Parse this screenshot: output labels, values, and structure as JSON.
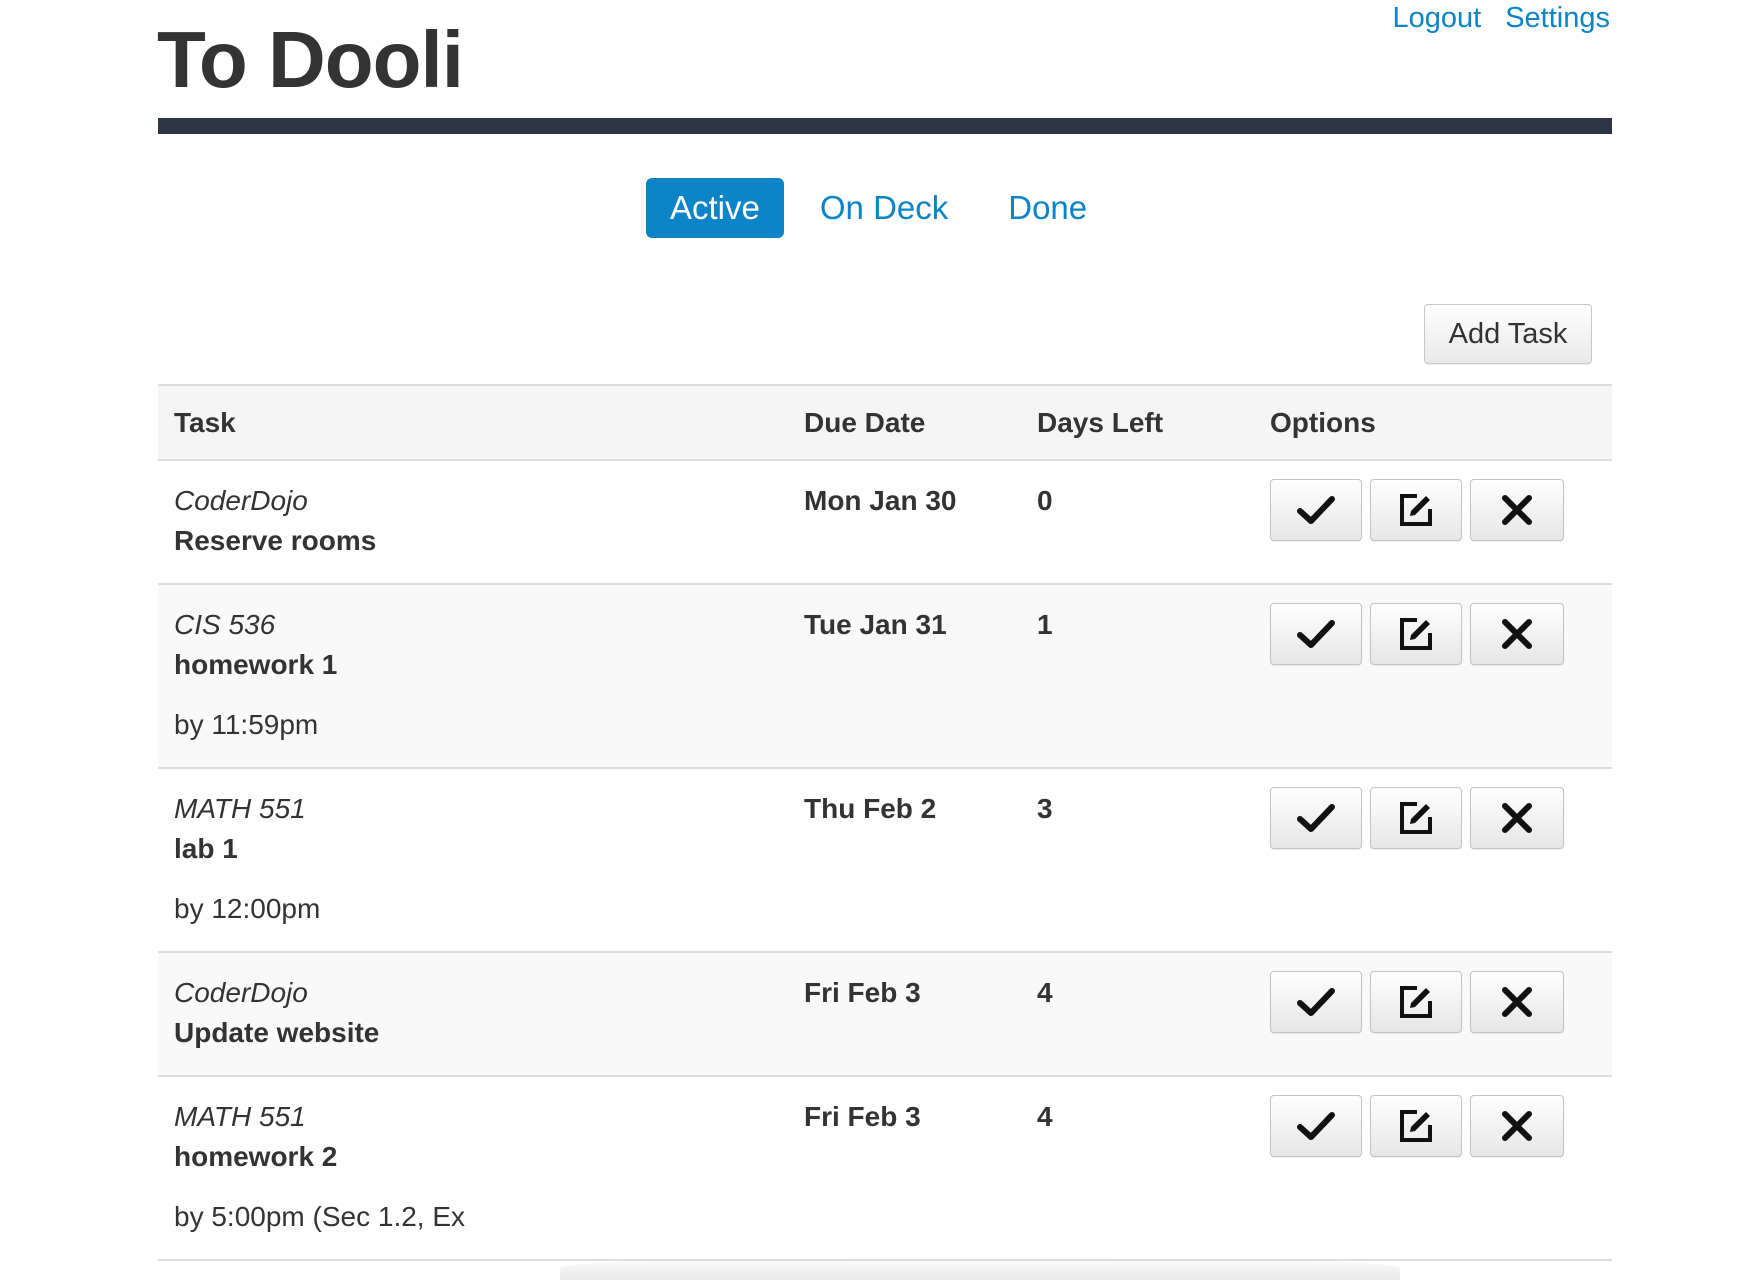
{
  "app": {
    "title": "To Dooli"
  },
  "header_links": {
    "logout": "Logout",
    "settings": "Settings"
  },
  "tabs": [
    {
      "label": "Active",
      "active": true
    },
    {
      "label": "On Deck",
      "active": false
    },
    {
      "label": "Done",
      "active": false
    }
  ],
  "toolbar": {
    "add_task_label": "Add Task"
  },
  "table": {
    "columns": [
      "Task",
      "Due Date",
      "Days Left",
      "Options"
    ],
    "rows": [
      {
        "course": "CoderDojo",
        "task": "Reserve rooms",
        "note": "",
        "due": "Mon Jan 30",
        "days_left": "0"
      },
      {
        "course": "CIS 536",
        "task": "homework 1",
        "note": "by 11:59pm",
        "due": "Tue Jan 31",
        "days_left": "1"
      },
      {
        "course": "MATH 551",
        "task": "lab 1",
        "note": "by 12:00pm",
        "due": "Thu Feb 2",
        "days_left": "3"
      },
      {
        "course": "CoderDojo",
        "task": "Update website",
        "note": "",
        "due": "Fri Feb 3",
        "days_left": "4"
      },
      {
        "course": "MATH 551",
        "task": "homework 2",
        "note": "by 5:00pm (Sec 1.2, Ex",
        "due": "Fri Feb 3",
        "days_left": "4"
      }
    ]
  },
  "icons": {
    "complete": "checkmark-icon",
    "edit": "edit-icon",
    "delete": "close-icon"
  },
  "colors": {
    "accent": "#0b84c8",
    "title_rule": "#2d3545",
    "text": "#333333"
  }
}
